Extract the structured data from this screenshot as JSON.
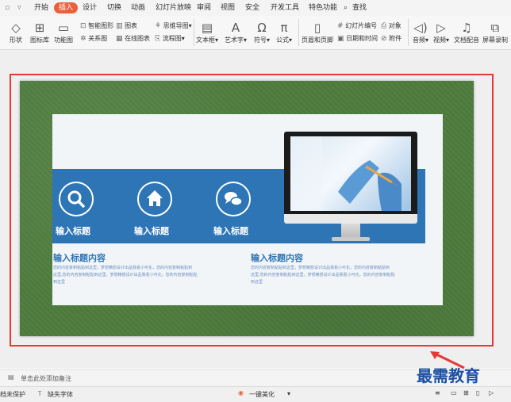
{
  "tabs": [
    "开始",
    "插入",
    "设计",
    "切换",
    "动画",
    "幻灯片放映",
    "审阅",
    "视图",
    "安全",
    "开发工具",
    "特色功能",
    "查找"
  ],
  "active_tab": "插入",
  "ribbon": {
    "shape": "形状",
    "icon_lib": "图标库",
    "func_chart": "功能图",
    "smart_shape": "智能图形",
    "chart": "图表",
    "mindmap": "思维导图",
    "relation": "关系图",
    "online_chart": "在线图表",
    "flowchart": "流程图",
    "textbox": "文本框",
    "wordart": "艺术字",
    "symbol": "符号",
    "formula": "公式",
    "header_footer": "页眉和页脚",
    "slide_number": "幻灯片编号",
    "object": "对象",
    "datetime": "日期和时间",
    "attachment": "附件",
    "audio": "音频",
    "video": "视频",
    "text_dub": "文档配音",
    "screen_rec": "屏幕录制"
  },
  "slide": {
    "band_titles": [
      "输入标题",
      "输入标题",
      "输入标题"
    ],
    "section_titles": [
      "输入标题内容",
      "输入标题内容"
    ],
    "body_left": [
      "您的内容复制粘贴到这里，梦想精想设计出品我看小可化，您的内容复制粘贴到",
      "这里,您的内容复制粘贴到这里，梦想精想设计出品我看小可化，您的内容复制粘贴",
      "到这里"
    ],
    "body_right": [
      "您的内容复制粘贴到这里，梦想精想设计出品我看小可化，您的内容复制粘贴到",
      "这里,您的内容复制粘贴到这里，梦想精想设计出品我看小可化，您的内容复制粘贴",
      "到这里"
    ]
  },
  "notes_placeholder": "单击此处添加备注",
  "status": {
    "doc_protect": "档未保护",
    "missing_font": "缺失字体",
    "beautify": "一键美化"
  },
  "watermark": "最需教育",
  "colors": {
    "active_tab": "#e8603c",
    "band": "#2e75b6",
    "highlight": "#e53935",
    "slide_bg": "#4c7a3c",
    "watermark": "#1e50a2"
  }
}
